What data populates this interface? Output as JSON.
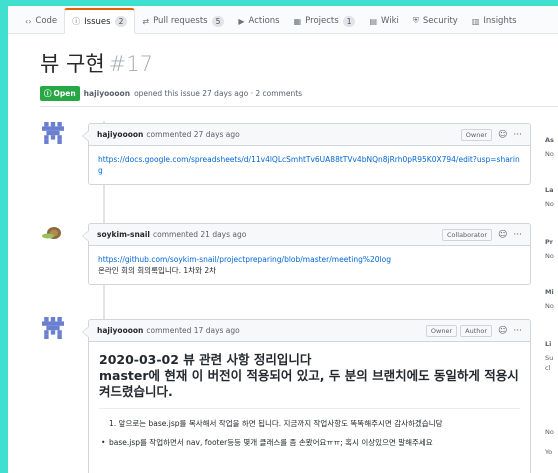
{
  "tabs": [
    {
      "icon": "‹›",
      "label": "Code",
      "count": ""
    },
    {
      "icon": "ⓘ",
      "label": "Issues",
      "count": "2"
    },
    {
      "icon": "⇄",
      "label": "Pull requests",
      "count": "5"
    },
    {
      "icon": "▶",
      "label": "Actions",
      "count": ""
    },
    {
      "icon": "▦",
      "label": "Projects",
      "count": "1"
    },
    {
      "icon": "▤",
      "label": "Wiki",
      "count": ""
    },
    {
      "icon": "⛨",
      "label": "Security",
      "count": ""
    },
    {
      "icon": "▥",
      "label": "Insights",
      "count": ""
    }
  ],
  "issue": {
    "title": "뷰 구현",
    "number": "#17",
    "state": "Open",
    "author": "hajiyoooon",
    "opened_text": "opened this issue 27 days ago · 2 comments"
  },
  "comments": [
    {
      "author": "hajiyoooon",
      "action": "commented 27 days ago",
      "role1": "Owner",
      "link": "https://docs.google.com/spreadsheets/d/11v4lQLcSmhtTv6UA88tTVv4bNQn8jRrh0pR95K0X794/edit?usp=sharing"
    },
    {
      "author": "soykim-snail",
      "action": "commented 21 days ago",
      "role1": "Collaborator",
      "link": "https://github.com/soykim-snail/projectpreparing/blob/master/meeting%20log",
      "text": "온라인 회의 회의록입니다. 1차와 2차"
    },
    {
      "author": "hajiyoooon",
      "action": "commented 17 days ago",
      "role1": "Owner",
      "role2": "Author",
      "heading_line1": "2020-03-02 뷰 관련 사항 정리입니다",
      "heading_line2": "master에 현재 이 버전이 적용되어 있고, 두 분의 브랜치에도 동일하게 적용시켜드렸습니다.",
      "item1": "1. 앞으로는 base.jsp를 복사해서 작업을 하면 됩니다. 지금까지 작업사항도 똑똑해주시면 감사하겠습니당",
      "item2": "base.jsp를 작업하면서 nav, footer등등 몇개 클래스를 좀 손봤어요ㅠㅠ; 혹시 이상있으면 말해주세요"
    }
  ],
  "sidebar": {
    "labels": [
      "As",
      "No",
      "La",
      "No",
      "Pr",
      "No",
      "Mi",
      "No",
      "Li",
      "Su",
      "cl",
      "No",
      "Yo"
    ]
  }
}
